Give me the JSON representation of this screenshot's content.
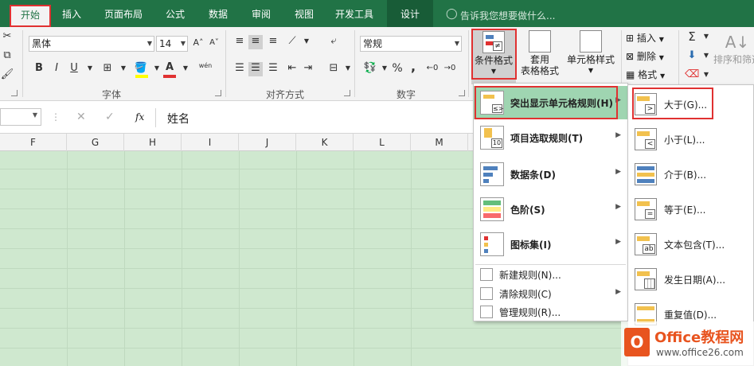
{
  "tabs": [
    {
      "label": "开始",
      "active": true
    },
    {
      "label": "插入"
    },
    {
      "label": "页面布局"
    },
    {
      "label": "公式"
    },
    {
      "label": "数据"
    },
    {
      "label": "审阅"
    },
    {
      "label": "视图"
    },
    {
      "label": "开发工具"
    },
    {
      "label": "设计"
    }
  ],
  "tell_me": {
    "placeholder": "告诉我您想要做什么..."
  },
  "font": {
    "name": "黑体",
    "size": "14",
    "bold": "B",
    "italic": "I",
    "underline": "U",
    "group_label": "字体",
    "pinyin": "wén"
  },
  "alignment": {
    "group_label": "对齐方式"
  },
  "number": {
    "format": "常规",
    "group_label": "数字",
    "percent": "%",
    "comma": ","
  },
  "styles": {
    "conditional_format": "条件格式",
    "table_format_1": "套用",
    "table_format_2": "表格格式",
    "cell_styles": "单元格样式"
  },
  "cells": {
    "insert": "插入",
    "delete": "删除",
    "format": "格式"
  },
  "editing": {
    "sort_filter": "排序和筛选"
  },
  "formula_bar": {
    "fx": "fx",
    "value": "姓名"
  },
  "columns": [
    "F",
    "G",
    "H",
    "I",
    "J",
    "K",
    "L",
    "M"
  ],
  "cf_menu": {
    "items": [
      {
        "label": "突出显示单元格规则(H)",
        "has_sub": true,
        "highlighted": true
      },
      {
        "label": "项目选取规则(T)",
        "has_sub": true
      },
      {
        "label": "数据条(D)",
        "has_sub": true
      },
      {
        "label": "色阶(S)",
        "has_sub": true
      },
      {
        "label": "图标集(I)",
        "has_sub": true
      }
    ],
    "small_items": [
      {
        "label": "新建规则(N)..."
      },
      {
        "label": "清除规则(C)",
        "has_sub": true
      },
      {
        "label": "管理规则(R)..."
      }
    ]
  },
  "highlight_submenu": {
    "items": [
      {
        "label": "大于(G)...",
        "symbol": ">"
      },
      {
        "label": "小于(L)...",
        "symbol": "<"
      },
      {
        "label": "介于(B)...",
        "symbol": ""
      },
      {
        "label": "等于(E)...",
        "symbol": "="
      },
      {
        "label": "文本包含(T)...",
        "symbol": "ab"
      },
      {
        "label": "发生日期(A)...",
        "symbol": ""
      },
      {
        "label": "重复值(D)...",
        "symbol": ""
      }
    ]
  },
  "watermark": {
    "line1": "Office教程网",
    "line2": "www.office26.com"
  },
  "colors": {
    "accent": "#217346",
    "highlight": "#9fd5b1",
    "sheet_bg": "#cfe8cf",
    "red_box": "#e03131"
  }
}
